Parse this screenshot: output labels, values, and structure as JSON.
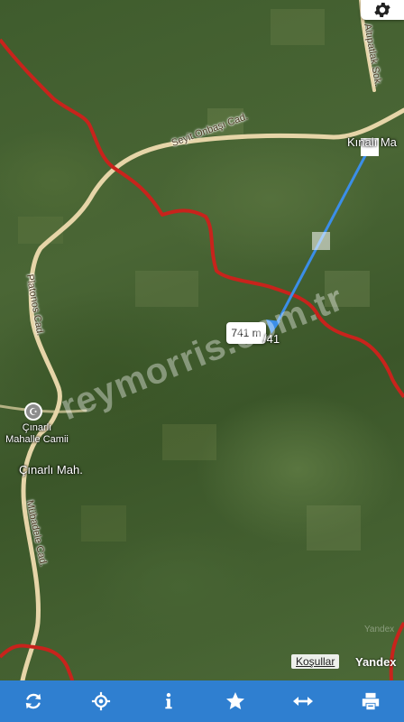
{
  "map": {
    "roads": {
      "seyit_onbasi": "Seyit Onbaşı Cad.",
      "platonos": "Platonos Cad.",
      "mubadele": "Mübadele Cad.",
      "altipatlak": "Altıpatlak Sok."
    },
    "places": {
      "cinarli_mah": "Çınarlı Mah.",
      "kinali_ma": "Kınalı Ma",
      "mosque_line1": "Çınarlı",
      "mosque_line2": "Mahalle Camii"
    },
    "measurement": {
      "distance": "741 m",
      "parcel": "/41"
    },
    "watermark": "reymorris.com.tr",
    "provider_faint": "Yandex",
    "icons": {
      "mosque": "mosque-icon",
      "settings": "gear-icon"
    }
  },
  "footer": {
    "terms_link": "Koşullar",
    "brand": "Yandex"
  },
  "toolbar": {
    "buttons": [
      {
        "icon": "refresh-icon"
      },
      {
        "icon": "locate-icon"
      },
      {
        "icon": "info-icon"
      },
      {
        "icon": "star-icon"
      },
      {
        "icon": "swap-horizontal-icon"
      },
      {
        "icon": "print-icon"
      }
    ]
  },
  "colors": {
    "toolbar": "#2f7fd0",
    "boundary": "#c8231c",
    "route": "#3b8ee8",
    "road": "#e6d5a8"
  }
}
